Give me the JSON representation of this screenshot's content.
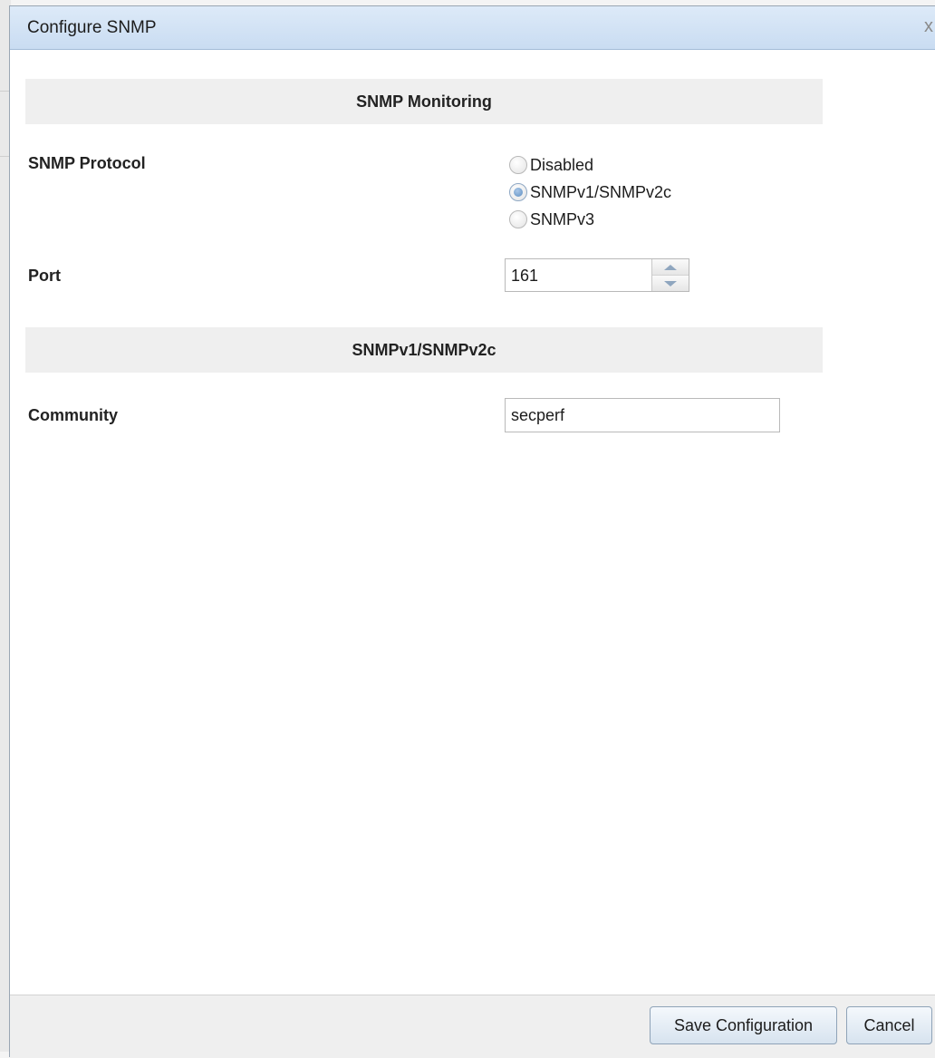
{
  "dialog": {
    "title": "Configure SNMP",
    "close_glyph": "x"
  },
  "sections": {
    "monitoring_header": "SNMP Monitoring",
    "v1v2_header": "SNMPv1/SNMPv2c"
  },
  "protocol": {
    "label": "SNMP Protocol",
    "options": [
      {
        "label": "Disabled",
        "checked": false
      },
      {
        "label": "SNMPv1/SNMPv2c",
        "checked": true
      },
      {
        "label": "SNMPv3",
        "checked": false
      }
    ]
  },
  "port": {
    "label": "Port",
    "value": "161"
  },
  "community": {
    "label": "Community",
    "value": "secperf"
  },
  "footer": {
    "save_label": "Save Configuration",
    "cancel_label": "Cancel"
  },
  "icons": {
    "close": "close-icon",
    "spin_up": "triangle-up-icon",
    "spin_down": "triangle-down-icon"
  },
  "colors": {
    "titlebar": "#c9dcf2",
    "section_bg": "#efefef",
    "button_border": "#8fa3b8",
    "radio_selected": "#5f8fc2"
  }
}
